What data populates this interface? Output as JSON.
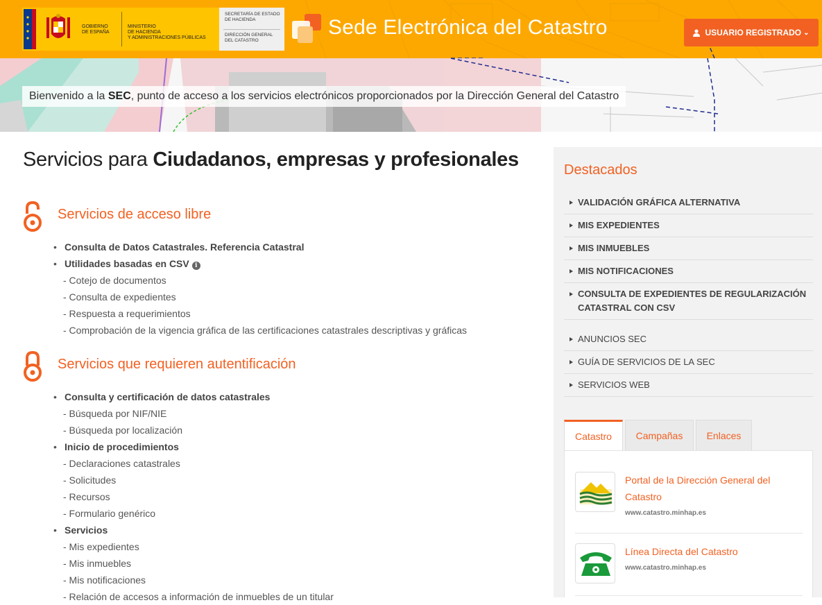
{
  "header": {
    "gov_left_text": [
      "GOBIERNO",
      "DE ESPAÑA"
    ],
    "ministry_text": [
      "MINISTERIO",
      "DE HACIENDA",
      "Y ADMINISTRACIONES PÚBLICAS"
    ],
    "secretaria_text": [
      "SECRETARÍA DE ESTADO",
      "DE HACIENDA"
    ],
    "direccion_text": [
      "DIRECCIÓN GENERAL",
      "DEL CATASTRO"
    ],
    "site_title": "Sede Electrónica del Catastro",
    "user_button": "USUARIO REGISTRADO",
    "colors": {
      "header_bg": "#fda800",
      "accent": "#f26122"
    }
  },
  "banner": {
    "welcome_pre": "Bienvenido a la",
    "welcome_bold": "SEC",
    "welcome_post": ", punto de acceso a los servicios electrónicos proporcionados por la Dirección General del Catastro"
  },
  "main": {
    "title_pre": "Servicios para",
    "title_bold": "Ciudadanos, empresas y profesionales",
    "section_free": {
      "title": "Servicios de acceso libre",
      "icon": "open-lock-icon",
      "items": [
        {
          "text": "Consulta de Datos Catastrales. Referencia Catastral",
          "type": "bold"
        },
        {
          "text": "Utilidades basadas en CSV",
          "type": "bold",
          "info": true
        },
        {
          "text": "- Cotejo de documentos",
          "type": "sub"
        },
        {
          "text": "- Consulta de expedientes",
          "type": "sub"
        },
        {
          "text": "- Respuesta a requerimientos",
          "type": "sub"
        },
        {
          "text": "- Comprobación de la vigencia gráfica de las certificaciones catastrales descriptivas y gráficas",
          "type": "sub"
        }
      ]
    },
    "section_auth": {
      "title": "Servicios que requieren autentificación",
      "icon": "lock-icon",
      "items": [
        {
          "text": "Consulta y certificación de datos catastrales",
          "type": "bold"
        },
        {
          "text": "- Búsqueda por NIF/NIE",
          "type": "sub"
        },
        {
          "text": "- Búsqueda por localización",
          "type": "sub"
        },
        {
          "text": "Inicio de procedimientos",
          "type": "bold"
        },
        {
          "text": "- Declaraciones catastrales",
          "type": "sub"
        },
        {
          "text": "- Solicitudes",
          "type": "sub"
        },
        {
          "text": "- Recursos",
          "type": "sub"
        },
        {
          "text": "- Formulario genérico",
          "type": "sub"
        },
        {
          "text": "Servicios",
          "type": "bold"
        },
        {
          "text": "- Mis expedientes",
          "type": "sub"
        },
        {
          "text": "- Mis inmuebles",
          "type": "sub"
        },
        {
          "text": "- Mis notificaciones",
          "type": "sub"
        },
        {
          "text": "- Relación de accesos a información de inmuebles de un titular",
          "type": "sub"
        }
      ]
    }
  },
  "sidebar": {
    "featured_title": "Destacados",
    "featured": [
      {
        "label": "VALIDACIÓN GRÁFICA ALTERNATIVA",
        "bold": true
      },
      {
        "label": "MIS EXPEDIENTES",
        "bold": true
      },
      {
        "label": "MIS INMUEBLES",
        "bold": true
      },
      {
        "label": "MIS NOTIFICACIONES",
        "bold": true
      },
      {
        "label": "CONSULTA DE EXPEDIENTES DE REGULARIZACIÓN CATASTRAL CON CSV",
        "bold": true
      },
      {
        "label": "ANUNCIOS SEC",
        "bold": false,
        "gap": true
      },
      {
        "label": "GUÍA DE SERVICIOS DE LA SEC",
        "bold": false
      },
      {
        "label": "SERVICIOS WEB",
        "bold": false
      }
    ],
    "tabs": [
      "Catastro",
      "Campañas",
      "Enlaces"
    ],
    "active_tab": "Catastro",
    "links": [
      {
        "title": "Portal de la Dirección General del Catastro",
        "url": "www.catastro.minhap.es",
        "icon": "catastro-logo-icon"
      },
      {
        "title": "Línea Directa del Catastro",
        "url": "www.catastro.minhap.es",
        "icon": "telephone-icon"
      }
    ]
  }
}
